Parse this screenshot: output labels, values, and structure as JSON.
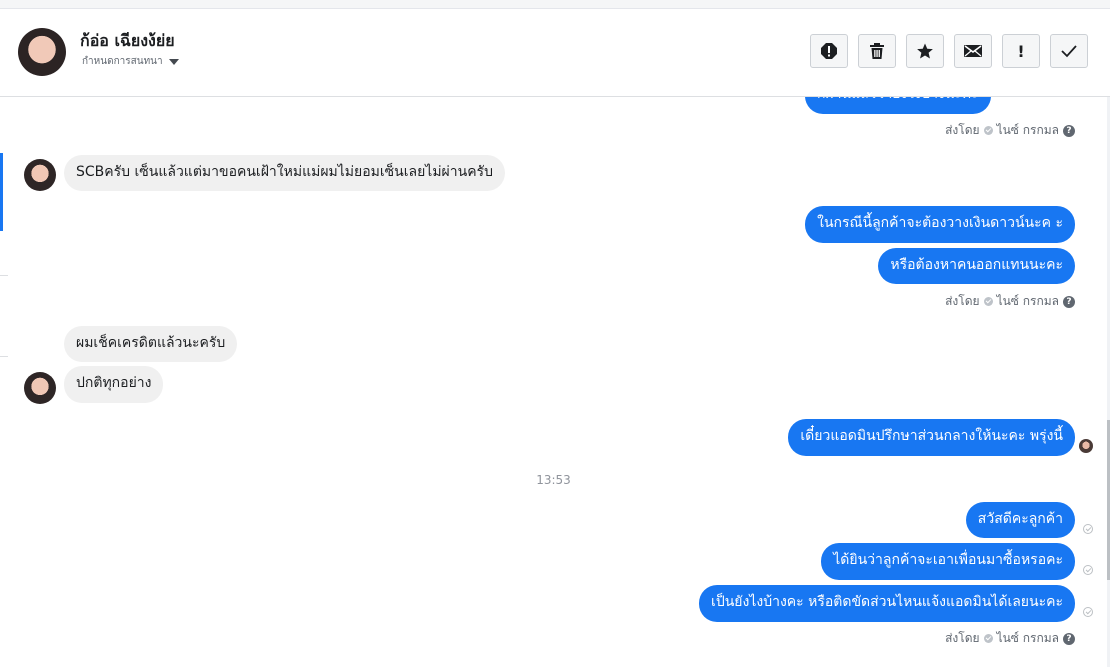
{
  "header": {
    "name": "ก้อ่อ เฉียงง้ย่ย",
    "subtitle": "กำหนดการสนทนา",
    "tools": [
      "report-icon",
      "trash-icon",
      "star-icon",
      "mail-icon",
      "exclamation-icon",
      "check-icon"
    ],
    "exclamation_glyph": "!"
  },
  "messages": {
    "top_partial": "กี่ผ่านแล้วว่ายังไงบ้างนะคะ",
    "meta_1": {
      "sent_by": "ส่งโดย",
      "sender": "ไนซ์ กรกมล",
      "help": "?"
    },
    "in_1": "SCBครับ เซ็นแล้วแต่มาขอคนเฝ้าใหม่แม่ผมไม่ยอมเซ็นเลยไม่ผ่านครับ",
    "out_1": "ในกรณีนี้ลูกค้าจะต้องวางเงินดาวน์นะค ะ",
    "out_2": "หรือต้องหาคนออกแทนนะคะ",
    "meta_2": {
      "sent_by": "ส่งโดย",
      "sender": "ไนซ์ กรกมล",
      "help": "?"
    },
    "in_2": "ผมเช็คเครดิตแล้วนะครับ",
    "in_3": "ปกติทุกอย่าง",
    "out_3": "เดี๋ยวแอดมินปรึกษาส่วนกลางให้นะคะ พรุ่งนี้",
    "time": "13:53",
    "out_4": "สวัสดีคะลูกค้า",
    "out_5": "ได้ยินว่าลูกค้าจะเอาเพื่อนมาซื้อหรอคะ",
    "out_6": "เป็นยังไงบ้างคะ หรือติดขัดส่วนไหนแจ้งแอดมินได้เลยนะคะ",
    "meta_3": {
      "sent_by": "ส่งโดย",
      "sender": "ไนซ์ กรกมล",
      "help": "?"
    }
  },
  "colors": {
    "accent": "#1877f2",
    "incoming": "#f0f0f0"
  }
}
